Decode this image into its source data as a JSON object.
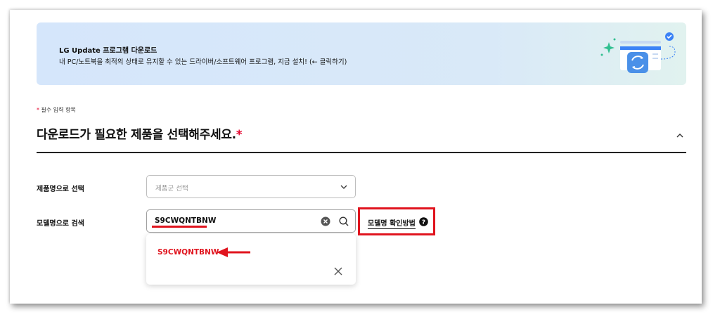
{
  "banner": {
    "title": "LG Update 프로그램 다운로드",
    "description": "내 PC/노트북을 최적의 상태로 유지할 수 있는 드라이버/소프트웨어 프로그램, 지금 설치! (← 클릭하기)"
  },
  "form": {
    "required_note": "필수 입력 항목",
    "required_mark": "*",
    "section_title": "다운로드가 필요한 제품을 선택해주세요.",
    "product_label": "제품명으로 선택",
    "product_placeholder": "제품군 선택",
    "model_label": "모델명으로 검색",
    "model_value": "S9CWQNTBNW",
    "howto_link": "모델명 확인방법",
    "suggestion": "S9CWQNTBNW"
  },
  "colors": {
    "accent_red": "#e0141e",
    "banner_bg": "#d5e6fb"
  },
  "icons": [
    "update-app-icon",
    "chevron-up-icon",
    "chevron-down-icon",
    "clear-icon",
    "search-icon",
    "help-icon",
    "arrow-left-icon",
    "close-icon"
  ]
}
